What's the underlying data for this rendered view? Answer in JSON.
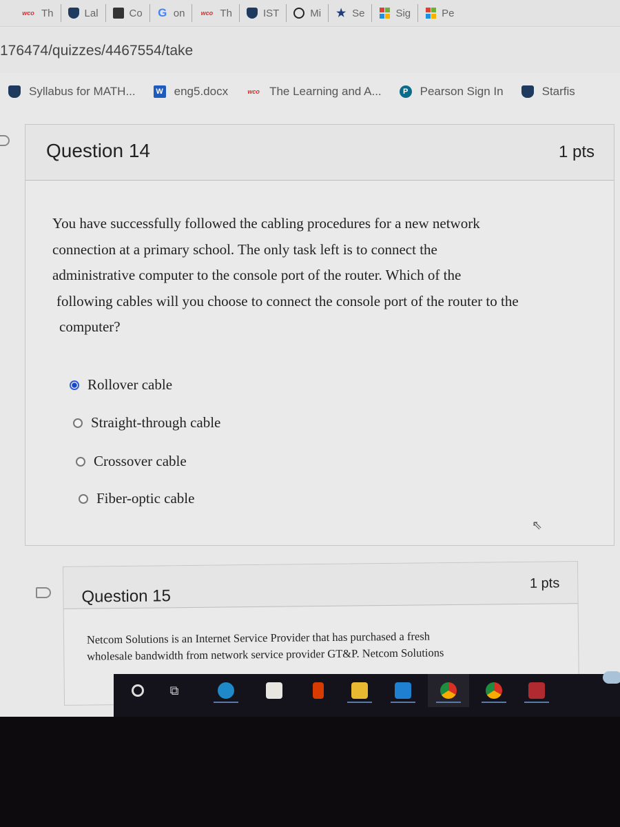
{
  "browser": {
    "tabs": [
      {
        "icon": "wco-icon",
        "label": "Th"
      },
      {
        "icon": "shield-icon",
        "label": "Lal"
      },
      {
        "icon": "document-icon",
        "label": "Co"
      },
      {
        "icon": "google-icon",
        "label": "on"
      },
      {
        "icon": "wco-icon",
        "label": "Th"
      },
      {
        "icon": "shield-icon",
        "label": "IST"
      },
      {
        "icon": "globe-icon",
        "label": "Mi"
      },
      {
        "icon": "star-icon",
        "label": "Se"
      },
      {
        "icon": "microsoft-icon",
        "label": "Sig"
      },
      {
        "icon": "microsoft-icon",
        "label": "Pe"
      }
    ],
    "url": "176474/quizzes/4467554/take",
    "bookmarks": [
      {
        "icon": "shield-icon",
        "label": "Syllabus for MATH..."
      },
      {
        "icon": "word-icon",
        "label": "eng5.docx"
      },
      {
        "icon": "wco-icon",
        "label": "The Learning and A..."
      },
      {
        "icon": "pearson-icon",
        "label": "Pearson Sign In"
      },
      {
        "icon": "shield-icon",
        "label": "Starfis"
      }
    ]
  },
  "icons": {
    "wco": "wco",
    "word": "W",
    "pearson": "P",
    "google": "G",
    "star": "★",
    "taskview": "⧉",
    "cursor": "⇖"
  },
  "quiz": {
    "questions": [
      {
        "title": "Question 14",
        "points": "1 pts",
        "text_lines": [
          "You have successfully followed the cabling procedures for a new network",
          "connection at a primary school. The only task left is to connect the",
          "administrative computer to the console port of the router. Which of the",
          "following cables will you choose to connect the console port of the router to the",
          "computer?"
        ],
        "options": [
          {
            "label": "Rollover cable",
            "selected": true
          },
          {
            "label": "Straight-through cable",
            "selected": false
          },
          {
            "label": "Crossover cable",
            "selected": false
          },
          {
            "label": "Fiber-optic cable",
            "selected": false
          }
        ]
      },
      {
        "title": "Question 15",
        "points": "1 pts",
        "text_lines": [
          "Netcom Solutions is an Internet Service Provider that has purchased a fresh",
          "wholesale bandwidth from network service provider GT&P. Netcom Solutions"
        ]
      }
    ]
  },
  "taskbar": {
    "items": [
      "search-icon",
      "task-view-icon",
      "edge-icon",
      "store-icon",
      "office-icon",
      "file-explorer-icon",
      "mail-icon",
      "chrome-icon",
      "chrome-profile-icon",
      "access-icon"
    ],
    "colors": {
      "edge": "#1e88c9",
      "store": "#e8e6e0",
      "office": "#d83b01",
      "explorer": "#e8b931",
      "mail": "#1f7fd1",
      "chrome": "#2e9c48",
      "access": "#b02a2f"
    }
  }
}
